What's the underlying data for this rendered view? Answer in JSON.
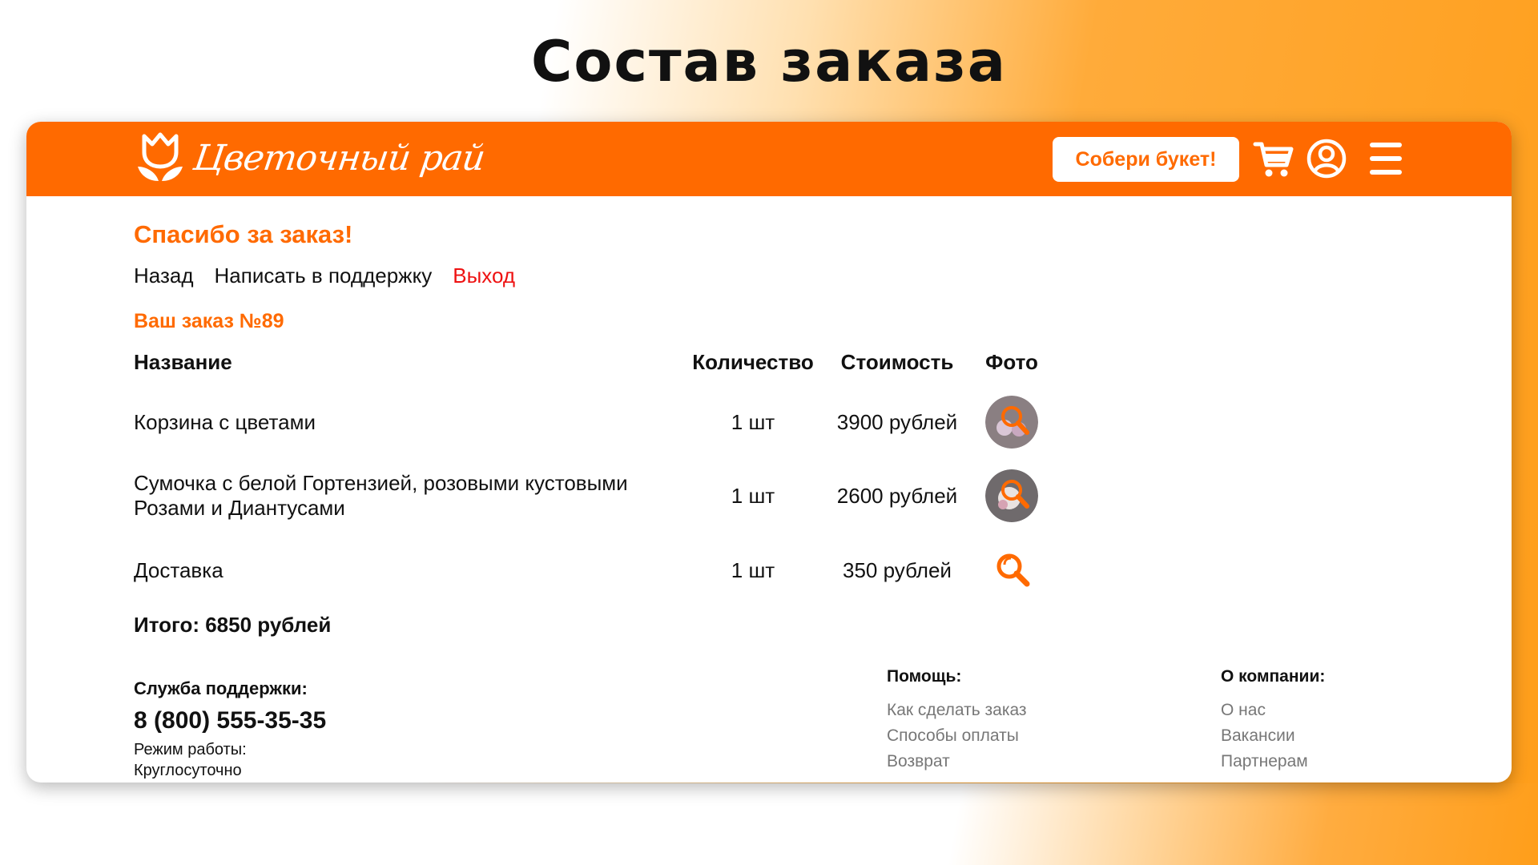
{
  "slide": {
    "title": "Состав заказа"
  },
  "header": {
    "logo_text": "Цветочный рай",
    "build_bouquet": "Собери букет!",
    "icons": [
      "cart-icon",
      "user-icon",
      "menu-icon"
    ],
    "brand_color": "#ff6a00"
  },
  "page": {
    "thanks": "Спасибо за заказ!",
    "nav": {
      "back": "Назад",
      "support": "Написать в поддержку",
      "logout": "Выход"
    },
    "order_number": "Ваш заказ №89",
    "table": {
      "headers": {
        "name": "Название",
        "qty": "Количество",
        "cost": "Стоимость",
        "photo": "Фото"
      },
      "rows": [
        {
          "name": "Корзина с цветами",
          "qty": "1 шт",
          "cost": "3900 рублей",
          "photo": "photo-thumbnail"
        },
        {
          "name": "Сумочка с белой Гортензией, розовыми кустовыми Розами и Диантусами",
          "qty": "1 шт",
          "cost": "2600 рублей",
          "photo": "photo-thumbnail"
        },
        {
          "name": "Доставка",
          "qty": "1 шт",
          "cost": "350 рублей",
          "photo": "magnifier-icon"
        }
      ]
    },
    "total": "Итого: 6850 рублей"
  },
  "footer": {
    "support_label": "Служба поддержки:",
    "phone": "8 (800) 555-35-35",
    "hours_label": "Режим работы:",
    "hours_value": "Круглосуточно",
    "help": {
      "title": "Помощь:",
      "links": [
        "Как сделать заказ",
        "Способы оплаты",
        "Возврат"
      ]
    },
    "company": {
      "title": "О компании:",
      "links": [
        "О нас",
        "Вакансии",
        "Партнерам"
      ]
    }
  }
}
